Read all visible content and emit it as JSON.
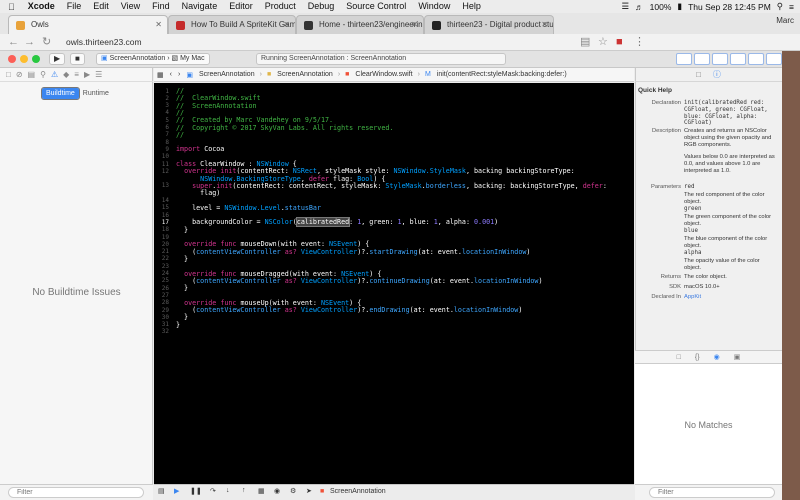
{
  "menubar": {
    "app": "Xcode",
    "items": [
      "File",
      "Edit",
      "View",
      "Find",
      "Navigate",
      "Editor",
      "Product",
      "Debug",
      "Source Control",
      "Window",
      "Help"
    ],
    "battery": "100%",
    "clock": "Thu Sep 28  12:45 PM"
  },
  "chrome": {
    "tabs": [
      {
        "title": "Owls",
        "color": "#e8a23a"
      },
      {
        "title": "How To Build A SpriteKit Game",
        "color": "#c52b2b"
      },
      {
        "title": "Home - thirteen23/engineerin",
        "color": "#333333"
      },
      {
        "title": "thirteen23 - Digital product stu",
        "color": "#222222"
      }
    ],
    "user": "Marc",
    "url": "owls.thirteen23.com"
  },
  "toolbar": {
    "scheme": "ScreenAnnotation",
    "destination": "My Mac",
    "status": "Running ScreenAnnotation : ScreenAnnotation"
  },
  "navigator": {
    "segments": [
      "Buildtime",
      "Runtime"
    ],
    "empty": "No Buildtime Issues",
    "filter_placeholder": "Filter"
  },
  "jumpbar": [
    "ScreenAnnotation",
    "ScreenAnnotation",
    "ClearWindow.swift",
    "init(contentRect:styleMask:backing:defer:)"
  ],
  "code": {
    "line_numbers": [
      "1",
      "2",
      "3",
      "4",
      "5",
      "6",
      "7",
      "8",
      "9",
      "10",
      "11",
      "12",
      "",
      "13",
      "",
      "14",
      "15",
      "16",
      "17",
      "18",
      "19",
      "20",
      "21",
      "22",
      "23",
      "24",
      "25",
      "26",
      "27",
      "28",
      "29",
      "30",
      "31",
      "32"
    ],
    "current_line": "17",
    "lines": [
      "//",
      "//  ClearWindow.swift",
      "//  ScreenAnnotation",
      "//",
      "//  Created by Marc Vandehey on 9/5/17.",
      "//  Copyright © 2017 SkyVan Labs. All rights reserved.",
      "//",
      "",
      "import Cocoa",
      "",
      "class ClearWindow : NSWindow {",
      "  override init(contentRect: NSRect, styleMask style: NSWindow.StyleMask, backing backingStoreType:",
      "      NSWindow.BackingStoreType, defer flag: Bool) {",
      "    super.init(contentRect: contentRect, styleMask: StyleMask.borderless, backing: backingStoreType, defer:",
      "      flag)",
      "",
      "    level = NSWindow.Level.statusBar",
      "",
      "    backgroundColor = NSColor(calibratedRed: 1, green: 1, blue: 1, alpha: 0.001)",
      "  }",
      "",
      "  override func mouseDown(with event: NSEvent) {",
      "    (contentViewController as? ViewController)?.startDrawing(at: event.locationInWindow)",
      "  }",
      "",
      "  override func mouseDragged(with event: NSEvent) {",
      "    (contentViewController as? ViewController)?.continueDrawing(at: event.locationInWindow)",
      "  }",
      "",
      "  override func mouseUp(with event: NSEvent) {",
      "    (contentViewController as? ViewController)?.endDrawing(at: event.locationInWindow)",
      "  }",
      "}",
      ""
    ]
  },
  "debugbar": {
    "target": "ScreenAnnotation"
  },
  "quickhelp": {
    "title": "Quick Help",
    "rows": [
      {
        "label": "Declaration",
        "value": "init(calibratedRed red: CGFloat, green: CGFloat, blue: CGFloat, alpha: CGFloat)"
      },
      {
        "label": "Description",
        "value": "Creates and returns an NSColor object using the given opacity and RGB components."
      },
      {
        "label": "",
        "value": "Values below 0.0 are interpreted as 0.0, and values above 1.0 are interpreted as 1.0."
      },
      {
        "label": "Parameters",
        "value": "red"
      },
      {
        "label": "",
        "value": "The red component of the color object."
      },
      {
        "label": "",
        "value": "green"
      },
      {
        "label": "",
        "value": "The green component of the color object."
      },
      {
        "label": "",
        "value": "blue"
      },
      {
        "label": "",
        "value": "The blue component of the color object."
      },
      {
        "label": "",
        "value": "alpha"
      },
      {
        "label": "",
        "value": "The opacity value of the color object."
      },
      {
        "label": "Returns",
        "value": "The color object."
      },
      {
        "label": "SDK",
        "value": "macOS 10.0+"
      },
      {
        "label": "Declared In",
        "value": "AppKit"
      }
    ],
    "library_empty": "No Matches",
    "filter_placeholder": "Filter"
  }
}
